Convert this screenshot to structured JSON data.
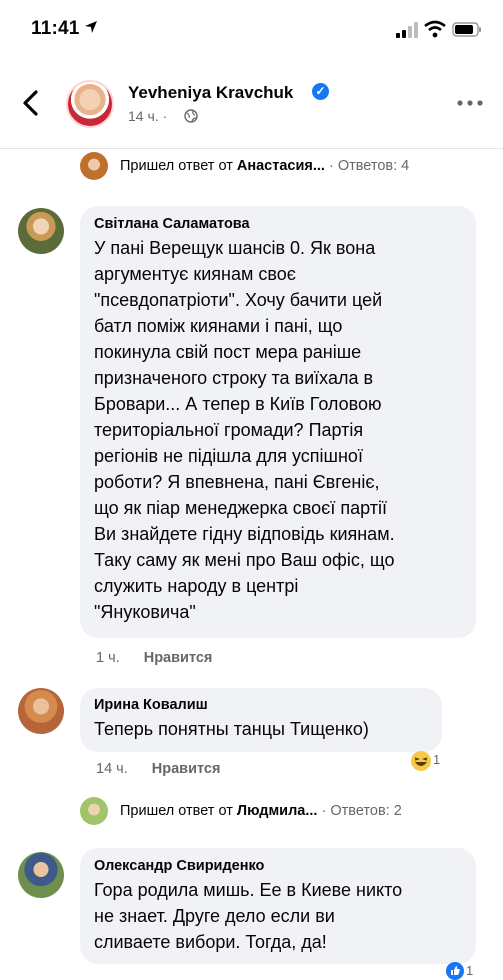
{
  "status_bar": {
    "time": "11:41"
  },
  "header": {
    "name": "Yevheniya Kravchuk",
    "time": "14 ч. · "
  },
  "reply_rows": [
    {
      "prefix": "Пришел ответ от ",
      "author": "Анастасия...",
      "count": " · Ответов: 4"
    },
    {
      "prefix": "Пришел ответ от ",
      "author": "Людмила...",
      "count": " · Ответов: 2"
    }
  ],
  "comments": [
    {
      "author": "Світлана Саламатова",
      "text": "У пані Верещук шансів 0. Як вона\nаргументує киянам своє\n\"псевдопатріоти\". Хочу бачити цей\nбатл поміж киянами і пані, що\nпокинула свій пост мера раніше\nпризначеного строку та виїхала в\nБровари... А тепер в Київ Головою\nтериторіальної громади? Партія\nрегіонів не підішла для успішної\nроботи? Я впевнена, пані Євгеніє,\nщо як піар менеджерка своєї партії\nВи знайдете гідну відповідь киянам.\nТаку саму як мені про Ваш офіс, що\nслужить народу в центрі\n\"Януковича\"",
      "time": "1 ч.",
      "like": "Нравится"
    },
    {
      "author": "Ирина Ковалиш",
      "text": "Теперь понятны танцы Тищенко)",
      "time": "14 ч.",
      "like": "Нравится",
      "reaction_icon": "laughing-emoji",
      "reaction_count": "1"
    },
    {
      "author": "Олександр Свириденко",
      "text": "Гора родила мишь. Ее в Киеве никто\nне знает. Друге дело если ви\nсливаете вибори. Тогда, да!",
      "reaction_count": "1"
    }
  ]
}
